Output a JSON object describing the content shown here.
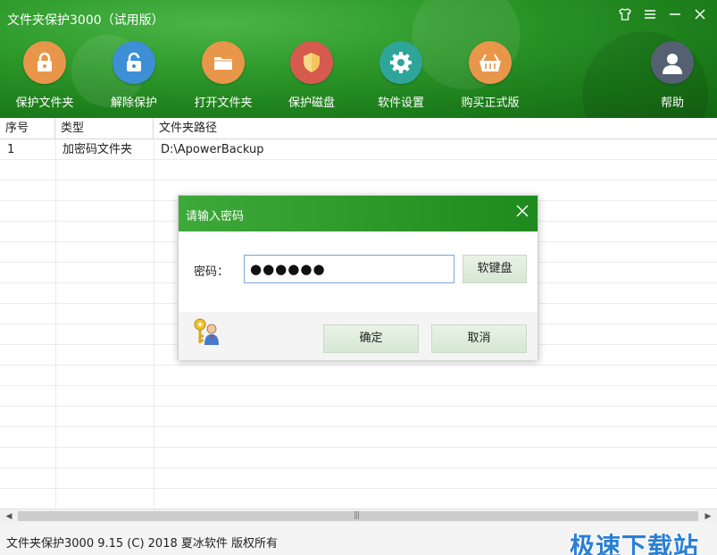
{
  "window": {
    "title": "文件夹保护3000（试用版）",
    "buttons": [
      {
        "name": "skin-button",
        "glyph": "👕"
      },
      {
        "name": "menu-button",
        "glyph": "☰"
      },
      {
        "name": "minimize-button",
        "glyph": "—"
      },
      {
        "name": "close-button",
        "glyph": "✕"
      }
    ]
  },
  "toolbar": {
    "items": [
      {
        "label": "保护文件夹",
        "icon": "lock-icon",
        "color": "#e8964a"
      },
      {
        "label": "解除保护",
        "icon": "unlock-icon",
        "color": "#3d8fd6"
      },
      {
        "label": "打开文件夹",
        "icon": "folder-icon",
        "color": "#e8964a"
      },
      {
        "label": "保护磁盘",
        "icon": "shield-icon",
        "color": "#d65a4e"
      },
      {
        "label": "软件设置",
        "icon": "gear-icon",
        "color": "#2fa59a"
      },
      {
        "label": "购买正式版",
        "icon": "basket-icon",
        "color": "#e8964a"
      },
      {
        "label": "帮助",
        "icon": "user-icon",
        "color": "#556173"
      }
    ]
  },
  "table": {
    "columns": [
      "序号",
      "类型",
      "文件夹路径"
    ],
    "rows": [
      {
        "index": "1",
        "type": "加密码文件夹",
        "path": "D:\\ApowerBackup"
      }
    ]
  },
  "status": {
    "text": "文件夹保护3000 9.15 (C) 2018 夏冰软件 版权所有",
    "watermark": "极速下载站"
  },
  "dialog": {
    "title": "请输入密码",
    "password_label": "密码：",
    "password_value": "●●●●●●",
    "keyboard_label": "软键盘",
    "ok_label": "确定",
    "cancel_label": "取消"
  }
}
